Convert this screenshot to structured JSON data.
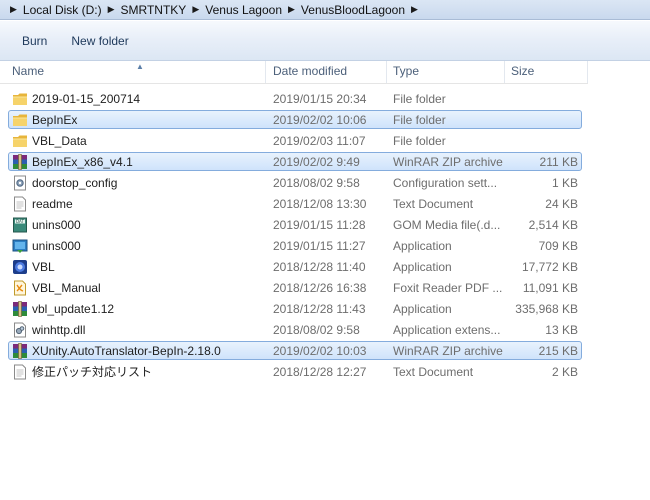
{
  "breadcrumb": [
    "Local Disk (D:)",
    "SMRTNTKY",
    "Venus Lagoon",
    "VenusBloodLagoon"
  ],
  "toolbar": {
    "burn_label": "Burn",
    "new_folder_label": "New folder"
  },
  "columns": {
    "name": "Name",
    "date": "Date modified",
    "type": "Type",
    "size": "Size"
  },
  "files": [
    {
      "name": "2019-01-15_200714",
      "date": "2019/01/15 20:34",
      "type": "File folder",
      "size": "",
      "icon": "folder-icon",
      "selected": false
    },
    {
      "name": "BepInEx",
      "date": "2019/02/02 10:06",
      "type": "File folder",
      "size": "",
      "icon": "folder-icon",
      "selected": true
    },
    {
      "name": "VBL_Data",
      "date": "2019/02/03 11:07",
      "type": "File folder",
      "size": "",
      "icon": "folder-icon",
      "selected": false
    },
    {
      "name": "BepInEx_x86_v4.1",
      "date": "2019/02/02 9:49",
      "type": "WinRAR ZIP archive",
      "size": "211 KB",
      "icon": "winrar-icon",
      "selected": true
    },
    {
      "name": "doorstop_config",
      "date": "2018/08/02 9:58",
      "type": "Configuration sett...",
      "size": "1 KB",
      "icon": "config-file-icon",
      "selected": false
    },
    {
      "name": "readme",
      "date": "2018/12/08 13:30",
      "type": "Text Document",
      "size": "24 KB",
      "icon": "text-file-icon",
      "selected": false
    },
    {
      "name": "unins000",
      "date": "2019/01/15 11:28",
      "type": "GOM Media file(.d...",
      "size": "2,514 KB",
      "icon": "gom-file-icon",
      "selected": false
    },
    {
      "name": "unins000",
      "date": "2019/01/15 11:27",
      "type": "Application",
      "size": "709 KB",
      "icon": "installer-icon",
      "selected": false
    },
    {
      "name": "VBL",
      "date": "2018/12/28 11:40",
      "type": "Application",
      "size": "17,772 KB",
      "icon": "app-icon",
      "selected": false
    },
    {
      "name": "VBL_Manual",
      "date": "2018/12/26 16:38",
      "type": "Foxit Reader PDF ...",
      "size": "11,091 KB",
      "icon": "pdf-icon",
      "selected": false
    },
    {
      "name": "vbl_update1.12",
      "date": "2018/12/28 11:43",
      "type": "Application",
      "size": "335,968 KB",
      "icon": "winrar-icon",
      "selected": false
    },
    {
      "name": "winhttp.dll",
      "date": "2018/08/02 9:58",
      "type": "Application extens...",
      "size": "13 KB",
      "icon": "dll-icon",
      "selected": false
    },
    {
      "name": "XUnity.AutoTranslator-BepIn-2.18.0",
      "date": "2019/02/02 10:03",
      "type": "WinRAR ZIP archive",
      "size": "215 KB",
      "icon": "winrar-icon",
      "selected": true
    },
    {
      "name": "修正パッチ対応リスト",
      "date": "2018/12/28 12:27",
      "type": "Text Document",
      "size": "2 KB",
      "icon": "text-file-icon",
      "selected": false
    }
  ]
}
